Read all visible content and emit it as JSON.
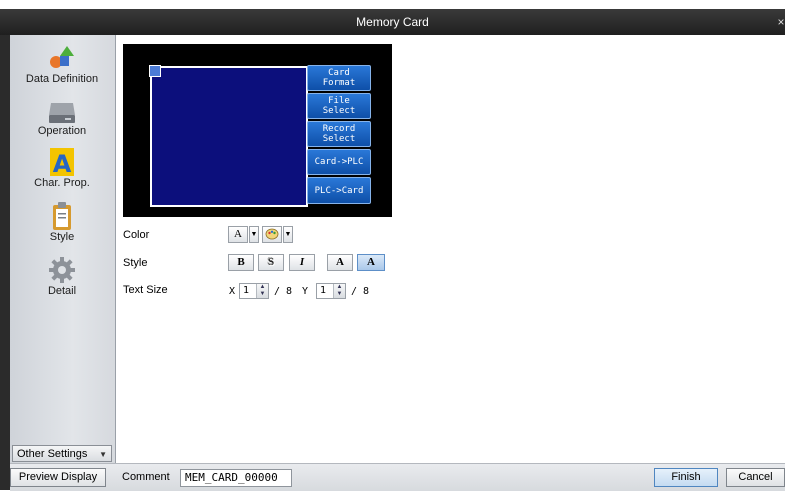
{
  "window": {
    "title": "Memory Card",
    "close_glyph": "×"
  },
  "sidebar": {
    "items": [
      {
        "label": "Data Definition",
        "icon": "shapes-icon"
      },
      {
        "label": "Operation",
        "icon": "drive-icon"
      },
      {
        "label": "Char. Prop.",
        "icon": "letter-a-icon",
        "selected": true
      },
      {
        "label": "Style",
        "icon": "clipboard-icon"
      },
      {
        "label": "Detail",
        "icon": "gear-icon"
      }
    ],
    "other_settings": "Other Settings"
  },
  "preview": {
    "buttons": [
      "Card\nFormat",
      "File\nSelect",
      "Record\nSelect",
      "Card->PLC",
      "PLC->Card"
    ],
    "screen_color": "#0c0f7c",
    "button_color": "#1a66c6"
  },
  "properties": {
    "color_label": "Color",
    "style_label": "Style",
    "text_size_label": "Text Size",
    "style_buttons": [
      "B",
      "S",
      "I",
      "A",
      "A"
    ],
    "char_color_glyph": "A",
    "text_size": {
      "x_label": "X",
      "x_value": "1",
      "x_suffix": "/ 8",
      "y_label": "Y",
      "y_value": "1",
      "y_suffix": "/ 8"
    }
  },
  "bottom": {
    "preview_display": "Preview Display",
    "comment_label": "Comment",
    "comment_value": "MEM_CARD_00000",
    "finish": "Finish",
    "cancel": "Cancel"
  }
}
